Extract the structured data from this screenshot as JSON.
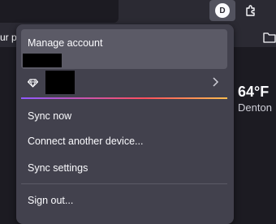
{
  "toolbar": {
    "account_avatar_letter": "D",
    "bookmark_text": "ur p"
  },
  "weather": {
    "temperature": "64°F",
    "city": "Denton"
  },
  "panel": {
    "manage_account_label": "Manage account",
    "items": [
      {
        "label": "Sync now"
      },
      {
        "label": "Connect another device..."
      },
      {
        "label": "Sync settings"
      },
      {
        "label": "Sign out..."
      }
    ]
  },
  "colors": {
    "panel_bg": "#42414d",
    "account_card_bg": "#5b5a66",
    "gradient": [
      "#9059ff",
      "#ff4f5e",
      "#ffbd4f"
    ]
  }
}
